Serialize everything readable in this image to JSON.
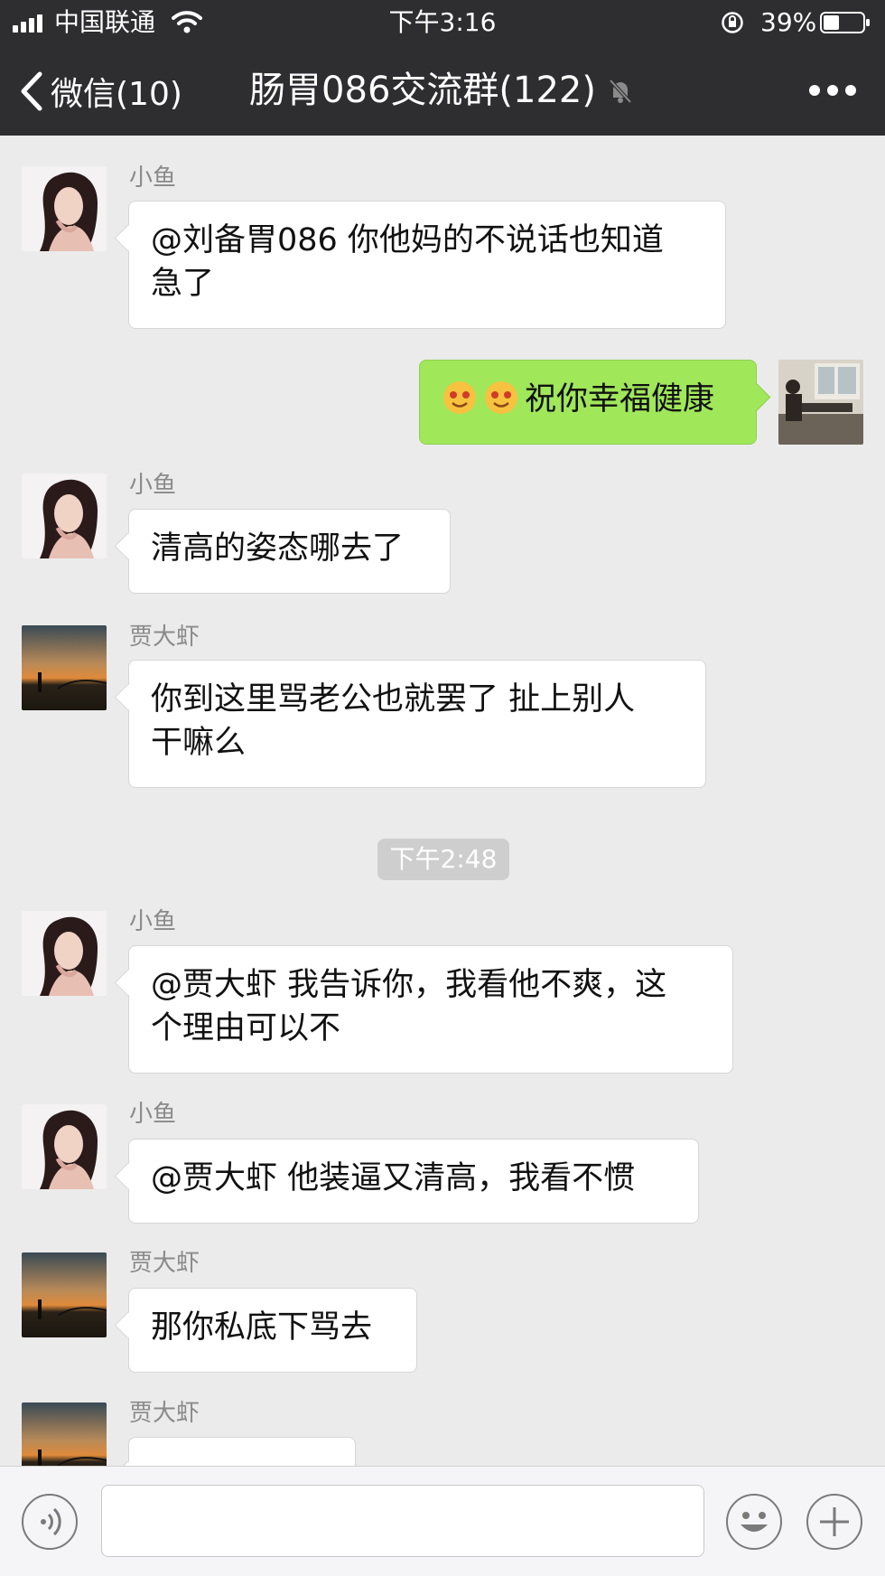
{
  "status_bar": {
    "carrier": "中国联通",
    "time": "下午3:16",
    "battery": "39%"
  },
  "nav": {
    "back_label": "微信(10)",
    "title": "肠胃086交流群(122)",
    "icons": [
      "chevron-left-icon",
      "mute-bell-icon",
      "more-icon"
    ]
  },
  "messages": [
    {
      "sender": "小鱼",
      "text": "@刘备胃086 你他妈的不说话也知道\n急了"
    },
    {
      "sender": "",
      "emoji": [
        "face-emoji",
        "face-emoji"
      ],
      "text": "祝你幸福健康"
    },
    {
      "sender": "小鱼",
      "text": "清高的姿态哪去了"
    },
    {
      "sender": "贾大虾",
      "text": "你到这里骂老公也就罢了 扯上别人\n干嘛么"
    },
    {
      "sender": "小鱼",
      "text": "@贾大虾 我告诉你，我看他不爽，这\n个理由可以不"
    },
    {
      "sender": "小鱼",
      "text": "@贾大虾 他装逼又清高，我看不惯"
    },
    {
      "sender": "贾大虾",
      "text": "那你私底下骂去"
    },
    {
      "sender": "贾大虾",
      "text": ""
    }
  ],
  "timestamp": "下午2:48",
  "input_bar": {
    "input_value": "",
    "icons": [
      "voice-icon",
      "emoji-icon",
      "plus-icon"
    ]
  },
  "colors": {
    "nav_bg": "#2e2e30",
    "chat_bg": "#ebebeb",
    "my_bubble": "#a0e75a",
    "their_bubble": "#ffffff"
  }
}
